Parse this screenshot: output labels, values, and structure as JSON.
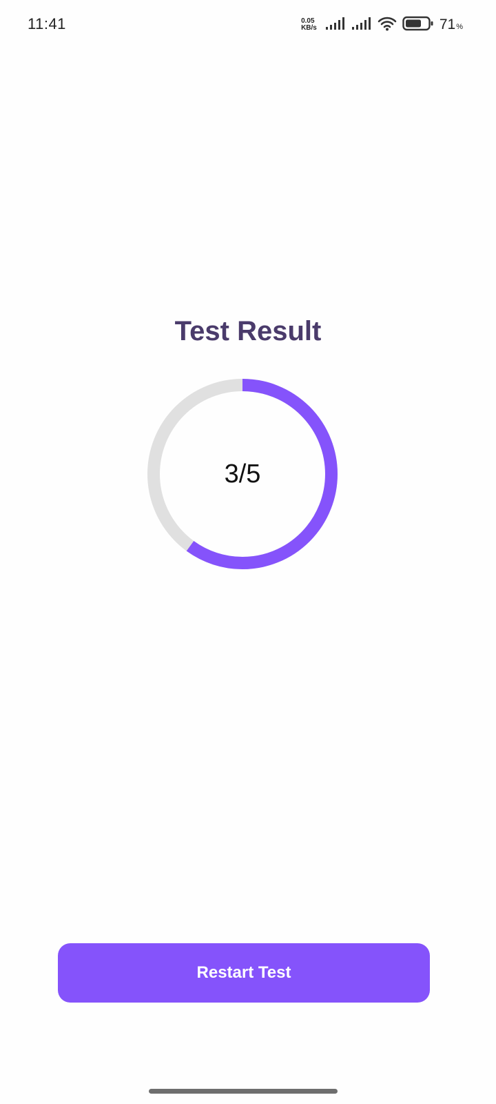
{
  "status_bar": {
    "time": "11:41",
    "net_speed_value": "0.05",
    "net_speed_unit": "KB/s",
    "battery_percent": "71",
    "battery_percent_sign": "%",
    "battery_level": 0.71,
    "icons": [
      "signal-icon",
      "signal-icon",
      "wifi-icon",
      "battery-icon"
    ]
  },
  "result": {
    "title": "Test Result",
    "score_label": "3/5",
    "score": 3,
    "total": 5,
    "colors": {
      "title": "#4a3b6b",
      "progress": "#8553fb",
      "track": "#e0e0e0"
    }
  },
  "actions": {
    "restart_label": "Restart Test",
    "button_color": "#8553fb"
  }
}
